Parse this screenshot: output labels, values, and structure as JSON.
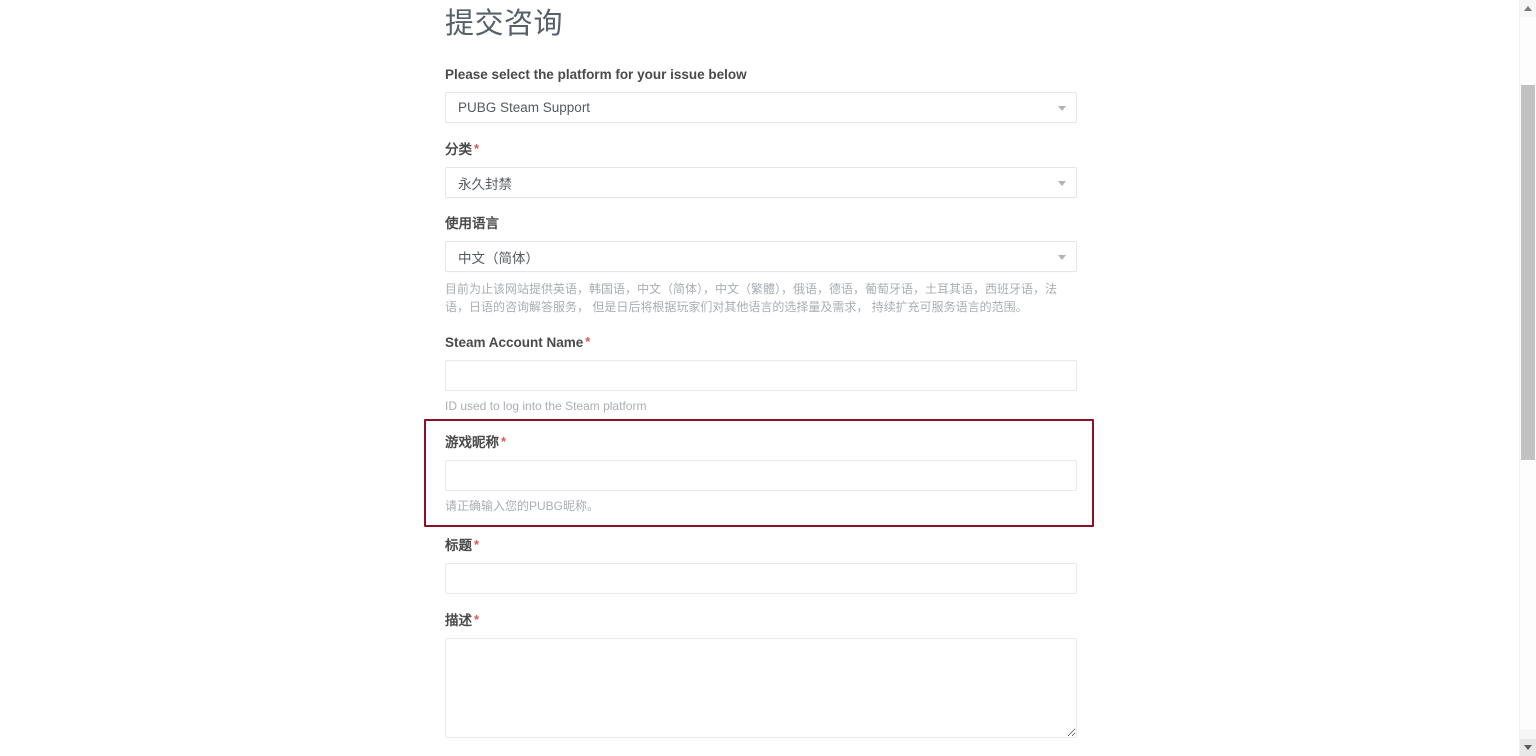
{
  "page": {
    "title": "提交咨询"
  },
  "form": {
    "platform": {
      "label": "Please select the platform for your issue below",
      "value": "PUBG Steam Support",
      "arrow_icon": "chevron-down-icon"
    },
    "category": {
      "label": "分类",
      "required_marker": "*",
      "value": "永久封禁",
      "arrow_icon": "chevron-down-icon"
    },
    "language": {
      "label": "使用语言",
      "value": "中文（简体）",
      "arrow_icon": "chevron-down-icon",
      "hint": "目前为止该网站提供英语，韩国语，中文（简体），中文（繁體），俄语，德语，葡萄牙语，土耳其语，西班牙语，法语，日语的咨询解答服务， 但是日后将根据玩家们对其他语言的选择量及需求， 持续扩充可服务语言的范围。"
    },
    "steam_account_name": {
      "label": "Steam Account Name",
      "required_marker": "*",
      "value": "",
      "placeholder": "",
      "hint": "ID used to log into the Steam platform"
    },
    "game_nickname": {
      "label": "游戏昵称",
      "required_marker": "*",
      "value": "",
      "placeholder": "",
      "hint": "请正确输入您的PUBG昵称。",
      "highlighted": true,
      "highlight_color": "#8c1127"
    },
    "subject": {
      "label": "标题",
      "required_marker": "*",
      "value": "",
      "placeholder": ""
    },
    "description": {
      "label": "描述",
      "required_marker": "*",
      "value": "",
      "placeholder": ""
    }
  },
  "scrollbar": {
    "up_arrow_icon": "scroll-up-arrow-icon",
    "down_arrow_icon": "scroll-down-arrow-icon",
    "thumb_name": "scrollbar-thumb"
  }
}
